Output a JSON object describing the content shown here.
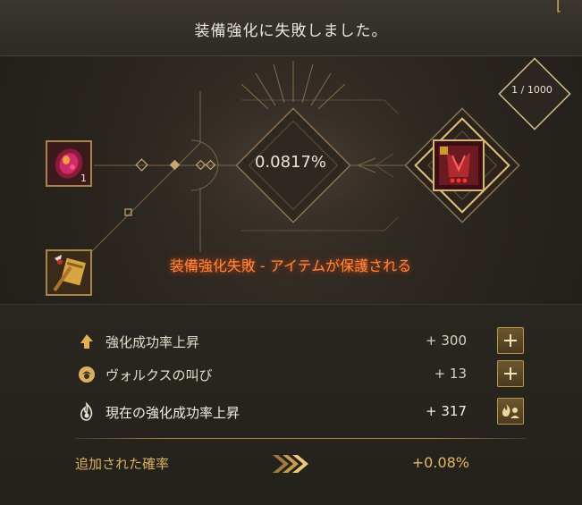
{
  "header": {
    "title": "装備強化に失敗しました。",
    "corner_glyph": "["
  },
  "enhance": {
    "material_count": "1",
    "success_rate": "0.0817%",
    "attempt_counter": "1 / 1000",
    "result_message": "装備強化失敗 - アイテムが保護される",
    "result_color": "#ff8a3a"
  },
  "stats": {
    "rows": [
      {
        "label": "強化成功率上昇",
        "value": "+ 300",
        "icon": "arrow-up-icon",
        "button": "plus-icon"
      },
      {
        "label": "ヴォルクスの叫び",
        "value": "+ 13",
        "icon": "valks-icon",
        "button": "plus-icon"
      },
      {
        "label": "現在の強化成功率上昇",
        "value": "+ 317",
        "icon": "flame-icon",
        "button": "support-icon"
      }
    ],
    "added_label": "追加された確率",
    "added_value": "+0.08%"
  },
  "colors": {
    "accent_gold": "#b08c46",
    "label_gold": "#d8b060",
    "frame_gold": "#a8854a"
  }
}
